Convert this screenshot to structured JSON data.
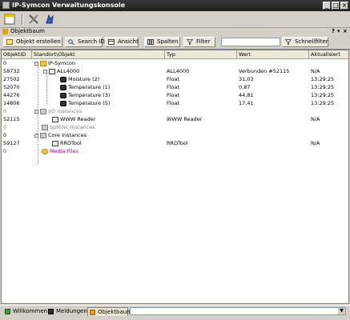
{
  "window": {
    "title": "IP-Symcon Verwaltungskonsole",
    "min": "_",
    "max": "□",
    "close": "×"
  },
  "panel": {
    "title": "Objektbaum",
    "help": "?",
    "pin": "▾",
    "close": "×"
  },
  "buttons": {
    "create": "Objekt erstellen",
    "search_id": "Search ID",
    "view": "Ansicht",
    "columns": "Spalten",
    "filter": "Filter",
    "quickfilter": "Schnellfilter",
    "search_value": ""
  },
  "columns": [
    "ObjektID",
    "Standort\\Objekt",
    "Typ",
    "Wert",
    "Aktualisiert"
  ],
  "rows": [
    {
      "id": "0",
      "name": "IP-Symcon",
      "typ": "",
      "wert": "",
      "akt": ""
    },
    {
      "id": "58732",
      "name": "ALL4000",
      "typ": "ALL4000",
      "wert": "Verbunden #52115",
      "akt": "N/A"
    },
    {
      "id": "27502",
      "name": "Moisture (2)",
      "typ": "Float",
      "wert": "31,03",
      "akt": "13:29:25"
    },
    {
      "id": "52070",
      "name": "Temperature (1)",
      "typ": "Float",
      "wert": "0,87",
      "akt": "13:29:25"
    },
    {
      "id": "44276",
      "name": "Temperature (3)",
      "typ": "Float",
      "wert": "44,81",
      "akt": "13:29:25"
    },
    {
      "id": "14806",
      "name": "Temperature (5)",
      "typ": "Float",
      "wert": "17,41",
      "akt": "13:29:25"
    },
    {
      "id": "0",
      "name": "I/O Instances",
      "typ": "",
      "wert": "",
      "akt": ""
    },
    {
      "id": "52115",
      "name": "WWW Reader",
      "typ": "WWW Reader",
      "wert": "",
      "akt": "N/A"
    },
    {
      "id": "0",
      "name": "Splitter Instances",
      "typ": "",
      "wert": "",
      "akt": ""
    },
    {
      "id": "0",
      "name": "Core Instances",
      "typ": "",
      "wert": "",
      "akt": ""
    },
    {
      "id": "59127",
      "name": "RRDTool",
      "typ": "RRDTool",
      "wert": "",
      "akt": "N/A"
    },
    {
      "id": "0",
      "name": "Media Files",
      "typ": "",
      "wert": "",
      "akt": ""
    }
  ],
  "tabs": [
    "Willkommen",
    "Meldungen",
    "Objektbaum"
  ],
  "combo_value": ""
}
